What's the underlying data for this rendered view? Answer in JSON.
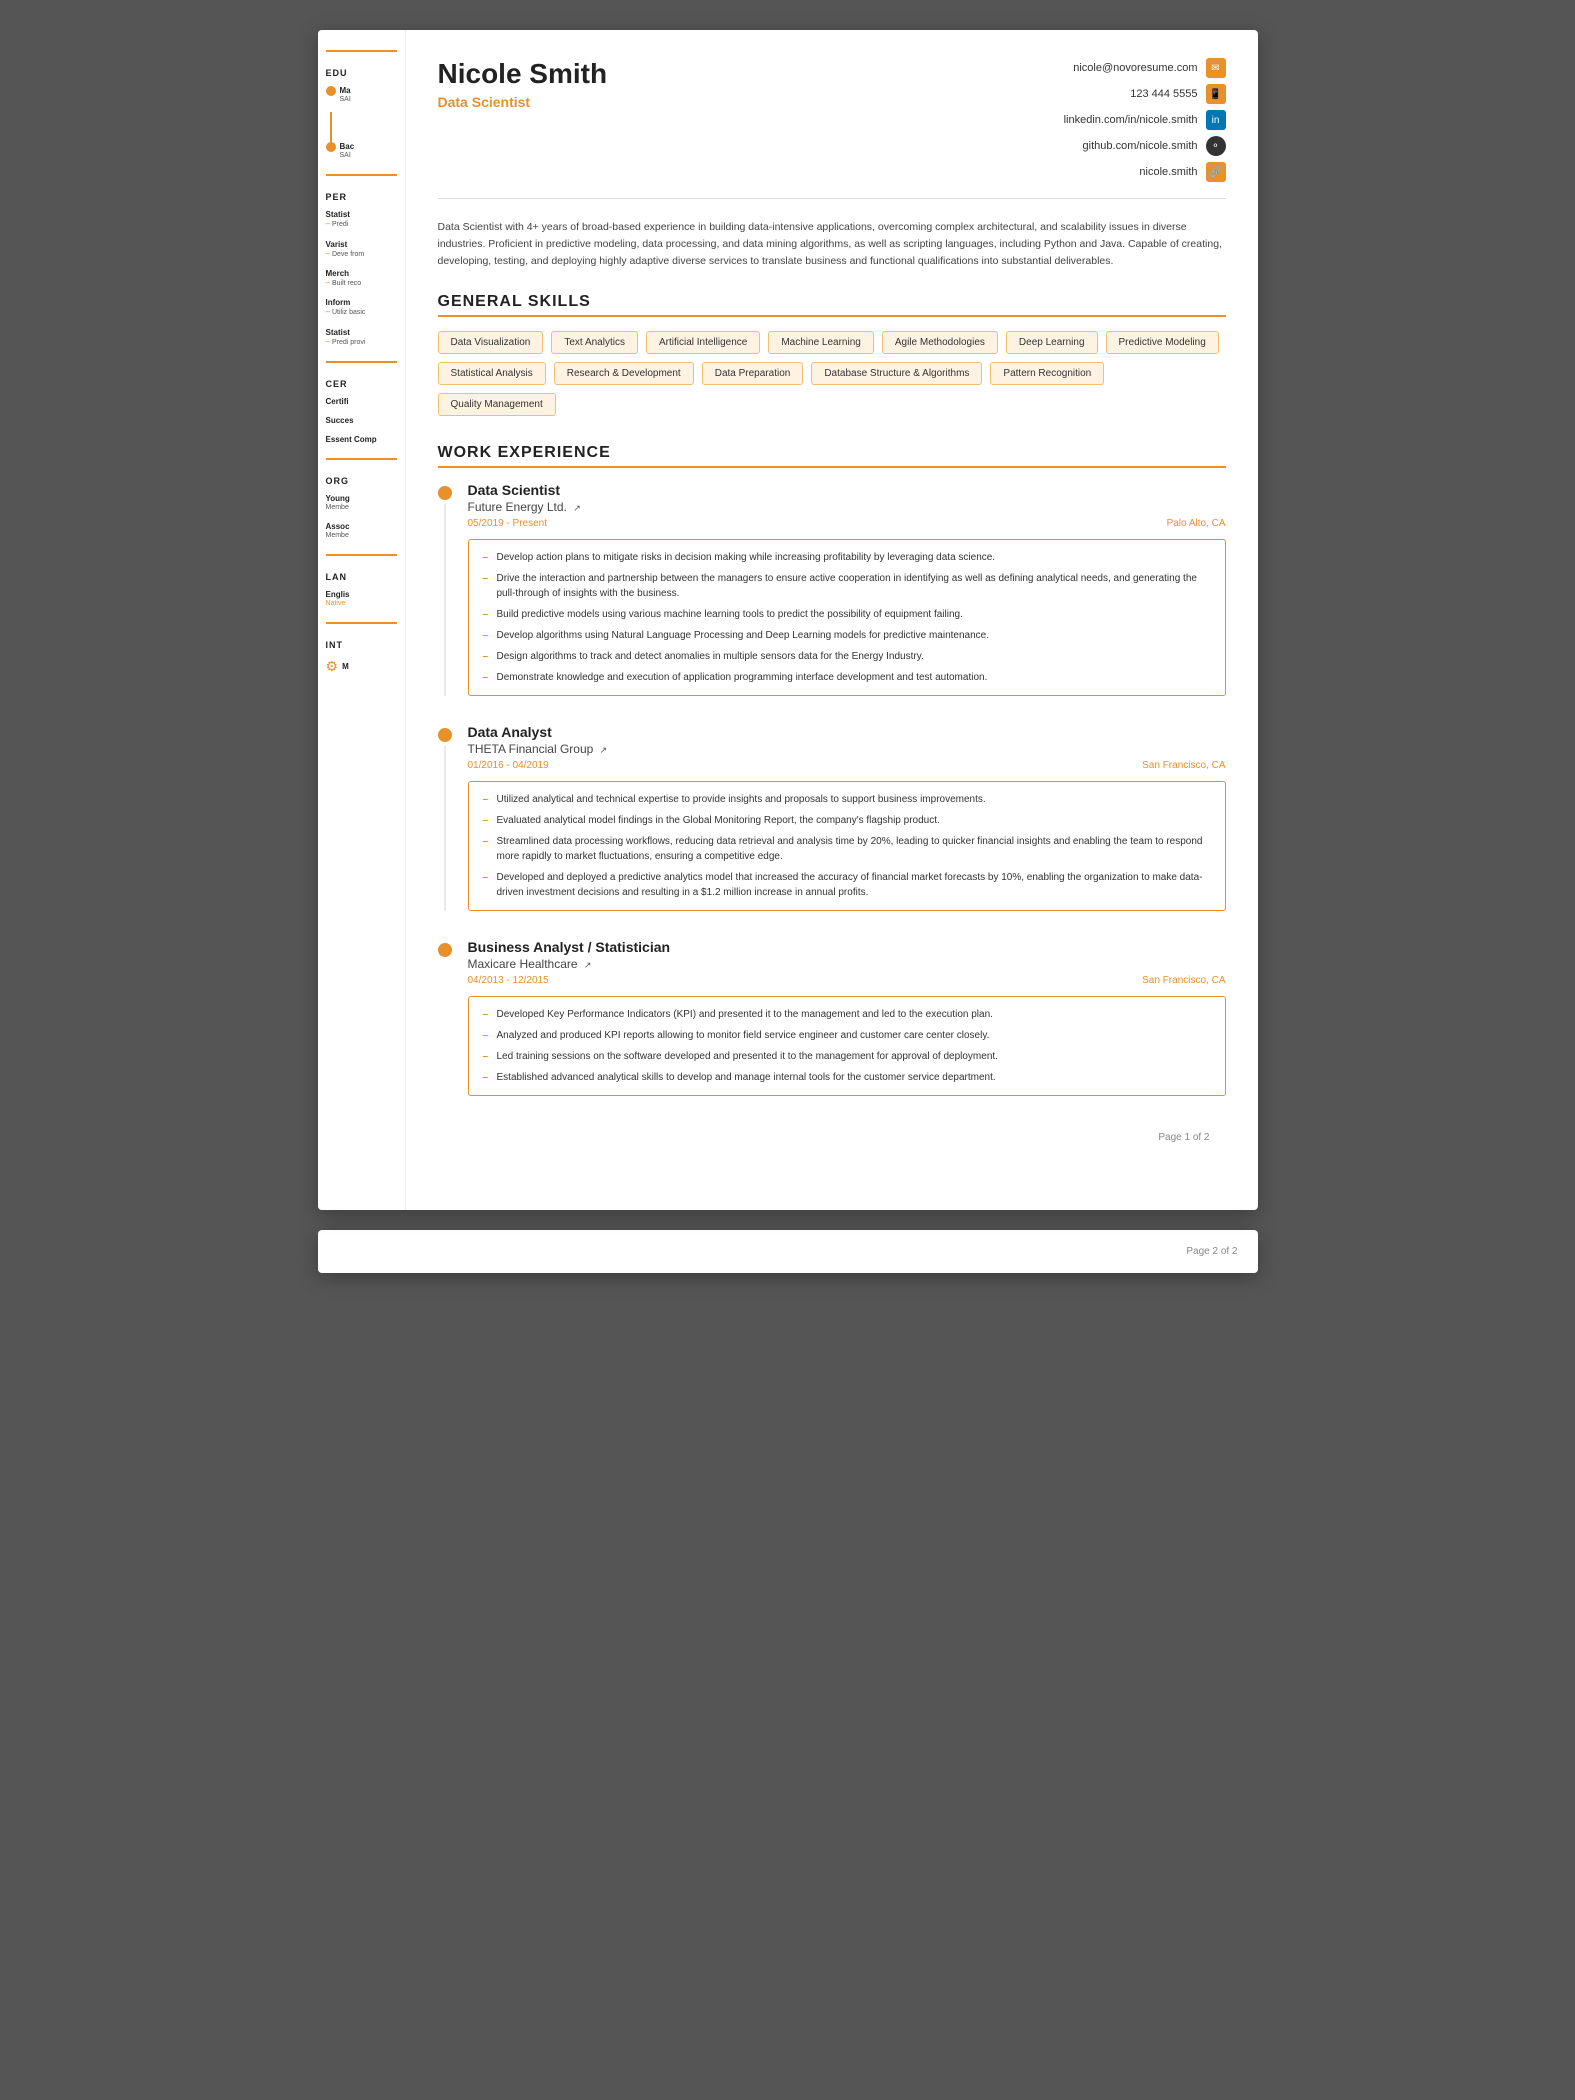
{
  "header": {
    "name": "Nicole Smith",
    "title": "Data Scientist",
    "contact": {
      "email": "nicole@novoresume.com",
      "phone": "123 444 5555",
      "linkedin": "linkedin.com/in/nicole.smith",
      "github": "github.com/nicole.smith",
      "website": "nicole.smith"
    }
  },
  "summary": "Data Scientist with 4+ years of broad-based experience in building data-intensive applications, overcoming complex architectural, and scalability issues in diverse industries. Proficient in predictive modeling, data processing, and data mining algorithms, as well as scripting languages, including Python and Java. Capable of creating, developing, testing, and deploying highly adaptive diverse services to translate business and functional qualifications into substantial deliverables.",
  "sections": {
    "general_skills": {
      "title": "GENERAL SKILLS",
      "skills": [
        "Data Visualization",
        "Text Analytics",
        "Artificial Intelligence",
        "Machine Learning",
        "Agile Methodologies",
        "Deep Learning",
        "Predictive Modeling",
        "Statistical Analysis",
        "Research & Development",
        "Data Preparation",
        "Database Structure & Algorithms",
        "Pattern Recognition",
        "Quality Management"
      ]
    },
    "work_experience": {
      "title": "WORK EXPERIENCE",
      "jobs": [
        {
          "title": "Data Scientist",
          "company": "Future Energy Ltd.",
          "dates": "05/2019 - Present",
          "location": "Palo Alto, CA",
          "bullets": [
            "Develop action plans to mitigate risks in decision making while increasing profitability by leveraging data science.",
            "Drive the interaction and partnership between the managers to ensure active cooperation in identifying as well as defining analytical needs, and generating the pull-through of insights with the business.",
            "Build predictive models using various machine learning tools to predict the possibility of equipment failing.",
            "Develop algorithms using Natural Language Processing and Deep Learning models for predictive maintenance.",
            "Design algorithms to track and detect anomalies in multiple sensors data for the Energy Industry.",
            "Demonstrate knowledge and execution of application programming interface development and test automation."
          ]
        },
        {
          "title": "Data Analyst",
          "company": "THETA Financial Group",
          "dates": "01/2016 - 04/2019",
          "location": "San Francisco, CA",
          "bullets": [
            "Utilized analytical and technical expertise to provide insights and proposals to support business improvements.",
            "Evaluated analytical model findings in the Global Monitoring Report, the company's flagship product.",
            "Streamlined data processing workflows, reducing data retrieval and analysis time by 20%, leading to quicker financial insights and enabling the team to respond more rapidly to market fluctuations, ensuring a competitive edge.",
            "Developed and deployed a predictive analytics model that increased the accuracy of financial market forecasts by 10%, enabling the organization to make data-driven investment decisions and resulting in a $1.2 million increase in annual profits."
          ]
        },
        {
          "title": "Business Analyst / Statistician",
          "company": "Maxicare Healthcare",
          "dates": "04/2013 - 12/2015",
          "location": "San Francisco, CA",
          "bullets": [
            "Developed Key Performance Indicators (KPI) and presented it to the management and led to the execution plan.",
            "Analyzed and produced KPI reports allowing to monitor field service engineer and customer care center closely.",
            "Led training sessions on the software developed and presented it to the management for approval of deployment.",
            "Established advanced analytical skills to develop and manage internal tools for the customer service department."
          ]
        }
      ]
    }
  },
  "sidebar": {
    "education": {
      "title": "EDU",
      "items": [
        {
          "degree": "Ma",
          "school": "SAI"
        },
        {
          "degree": "Bac",
          "school": "SAI"
        }
      ]
    },
    "personal": {
      "title": "PER",
      "items": [
        {
          "label": "Statist",
          "sub": "Predi"
        },
        {
          "label": "Varist",
          "sub": "Deve from"
        },
        {
          "label": "Merch",
          "sub": "Built reco"
        },
        {
          "label": "Inform",
          "sub": "Utiliz basic"
        },
        {
          "label": "Statist",
          "sub": "Predi provi"
        }
      ]
    },
    "certifications": {
      "title": "CER",
      "items": [
        {
          "label": "Certifi"
        },
        {
          "label": "Succes"
        },
        {
          "label": "Essent Comp"
        }
      ]
    },
    "organizations": {
      "title": "ORG",
      "items": [
        {
          "label": "Young",
          "sub": "Membe"
        },
        {
          "label": "Assoc",
          "sub": "Membe"
        }
      ]
    },
    "languages": {
      "title": "LAN",
      "items": [
        {
          "label": "Englis",
          "sub": "Native"
        }
      ]
    },
    "interests": {
      "title": "INT",
      "items": [
        {
          "label": "M"
        }
      ]
    }
  },
  "page_numbers": {
    "page1": "Page 1 of 2",
    "page2": "Page 2 of 2"
  }
}
